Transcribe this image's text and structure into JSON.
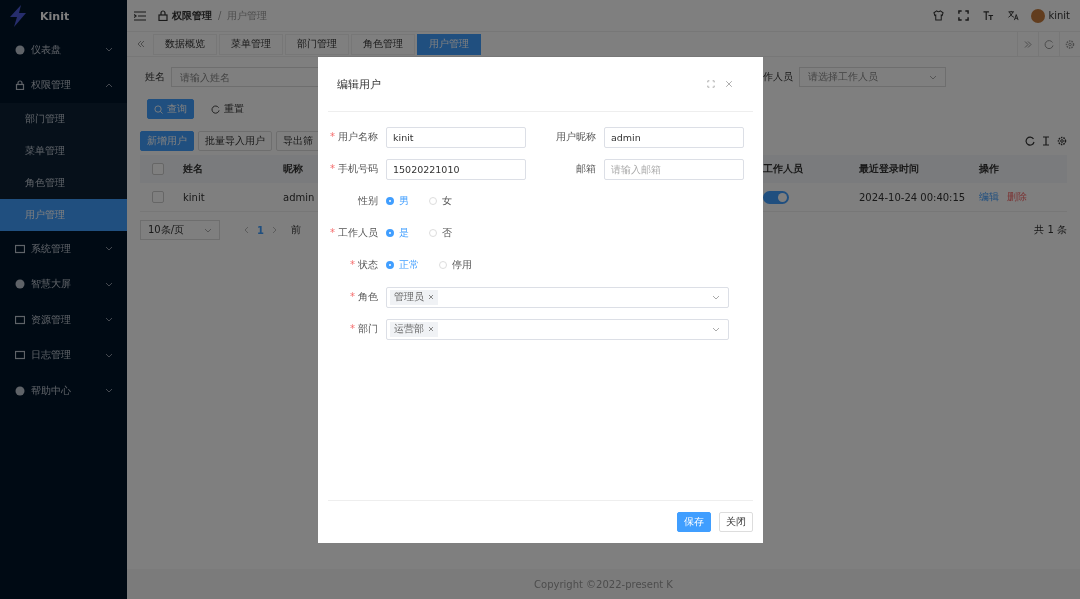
{
  "app": {
    "name": "Kinit"
  },
  "sidebar": {
    "items": [
      {
        "label": "仪表盘",
        "expanded": false
      },
      {
        "label": "权限管理",
        "expanded": true,
        "children": [
          {
            "label": "部门管理",
            "selected": false
          },
          {
            "label": "菜单管理",
            "selected": false
          },
          {
            "label": "角色管理",
            "selected": false
          },
          {
            "label": "用户管理",
            "selected": true
          }
        ]
      },
      {
        "label": "系统管理",
        "expanded": false
      },
      {
        "label": "智慧大屏",
        "expanded": false
      },
      {
        "label": "资源管理",
        "expanded": false
      },
      {
        "label": "日志管理",
        "expanded": false
      },
      {
        "label": "帮助中心",
        "expanded": false
      }
    ]
  },
  "header": {
    "breadcrumb": [
      "权限管理",
      "用户管理"
    ],
    "separator": "/",
    "user": "kinit"
  },
  "tabs": [
    {
      "label": "数据概览",
      "selected": false
    },
    {
      "label": "菜单管理",
      "selected": false
    },
    {
      "label": "部门管理",
      "selected": false
    },
    {
      "label": "角色管理",
      "selected": false
    },
    {
      "label": "用户管理",
      "selected": true
    }
  ],
  "search": {
    "name_label": "姓名",
    "name_placeholder": "请输入姓名",
    "staff_label": "作人员",
    "staff_placeholder": "请选择工作人员",
    "query": "查询",
    "reset": "重置"
  },
  "toolbar": [
    "新增用户",
    "批量导入用户",
    "导出筛"
  ],
  "table": {
    "select_all": false,
    "left_columns": [
      "姓名",
      "昵称"
    ],
    "right_columns": [
      "工作人员",
      "最近登录时间",
      "操作"
    ],
    "rows": [
      {
        "checked": false,
        "name": "kinit",
        "nickname": "admin",
        "staff": true,
        "last_login": "2024-10-24 00:40:15",
        "actions": [
          "编辑",
          "删除"
        ]
      }
    ]
  },
  "pagination": {
    "page_size": "10条/页",
    "page": "1",
    "goto": "前",
    "total": "共 1 条"
  },
  "footer": "Copyright ©2022-present K",
  "dialog": {
    "title": "编辑用户",
    "required_mark": "*",
    "rows": [
      [
        {
          "kind": "text",
          "label": "用户名称",
          "required": true,
          "value": "kinit"
        },
        {
          "kind": "text",
          "label": "用户昵称",
          "required": false,
          "value": "admin"
        }
      ],
      [
        {
          "kind": "text",
          "label": "手机号码",
          "required": true,
          "value": "15020221010"
        },
        {
          "kind": "text",
          "label": "邮箱",
          "required": false,
          "placeholder": "请输入邮箱"
        }
      ],
      [
        {
          "kind": "radio",
          "label": "性别",
          "required": false,
          "options": [
            {
              "label": "男",
              "selected": true
            },
            {
              "label": "女",
              "selected": false
            }
          ]
        }
      ],
      [
        {
          "kind": "radio",
          "label": "工作人员",
          "required": true,
          "options": [
            {
              "label": "是",
              "selected": true
            },
            {
              "label": "否",
              "selected": false
            }
          ]
        }
      ],
      [
        {
          "kind": "radio",
          "label": "状态",
          "required": true,
          "options": [
            {
              "label": "正常",
              "selected": true
            },
            {
              "label": "停用",
              "selected": false
            }
          ]
        }
      ],
      [
        {
          "kind": "select",
          "label": "角色",
          "required": true,
          "tags": [
            "管理员"
          ]
        }
      ],
      [
        {
          "kind": "select",
          "label": "部门",
          "required": true,
          "tags": [
            "运营部"
          ]
        }
      ]
    ],
    "save": "保存",
    "close": "关闭"
  }
}
